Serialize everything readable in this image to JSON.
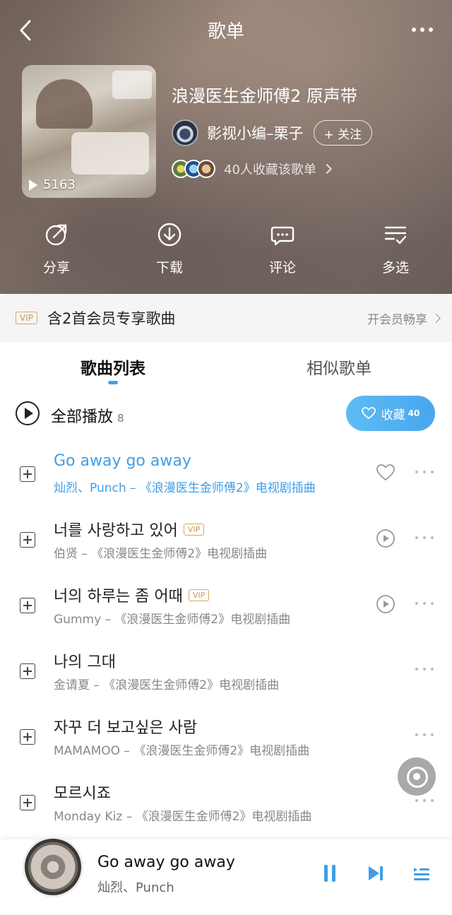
{
  "header": {
    "title": "歌单"
  },
  "playlist": {
    "play_count": "5163",
    "title": "浪漫医生金师傅2 原声带",
    "creator": "影视小编–栗子",
    "follow_label": "+ 关注",
    "collectors_text": "40人收藏该歌单"
  },
  "actions": [
    {
      "label": "分享",
      "icon": "share-icon"
    },
    {
      "label": "下载",
      "icon": "download-icon"
    },
    {
      "label": "评论",
      "icon": "comment-icon"
    },
    {
      "label": "多选",
      "icon": "multi-select-icon"
    }
  ],
  "vip_banner": {
    "tag": "VIP",
    "text": "含2首会员专享歌曲",
    "open": "开会员畅享"
  },
  "tabs": [
    "歌曲列表",
    "相似歌单"
  ],
  "play_all": {
    "label": "全部播放",
    "count": "8",
    "favorite_label": "收藏",
    "favorite_count": "40"
  },
  "songs": [
    {
      "title": "Go away go away",
      "subtitle": "灿烈、Punch – 《浪漫医生金师傅2》电视剧插曲",
      "vip": "",
      "playing": true
    },
    {
      "title": "너를 사랑하고 있어",
      "subtitle": "伯贤 – 《浪漫医生金师傅2》电视剧插曲",
      "vip": "VIP",
      "playing": false
    },
    {
      "title": "너의 하루는 좀 어때",
      "subtitle": "Gummy – 《浪漫医生金师傅2》电视剧插曲",
      "vip": "VIP",
      "playing": false
    },
    {
      "title": "나의 그대",
      "subtitle": "金请夏 – 《浪漫医生金师傅2》电视剧插曲",
      "vip": "",
      "playing": false
    },
    {
      "title": "자꾸 더 보고싶은 사람",
      "subtitle": "MAMAMOO – 《浪漫医生金师傅2》电视剧插曲",
      "vip": "",
      "playing": false
    },
    {
      "title": "모르시죠",
      "subtitle": "Monday Kiz – 《浪漫医生金师傅2》电视剧插曲",
      "vip": "",
      "playing": false
    }
  ],
  "player": {
    "title": "Go away go away",
    "artist": "灿烈、Punch"
  },
  "colors": {
    "accent": "#3f9ee6",
    "vip": "#c99a52"
  }
}
